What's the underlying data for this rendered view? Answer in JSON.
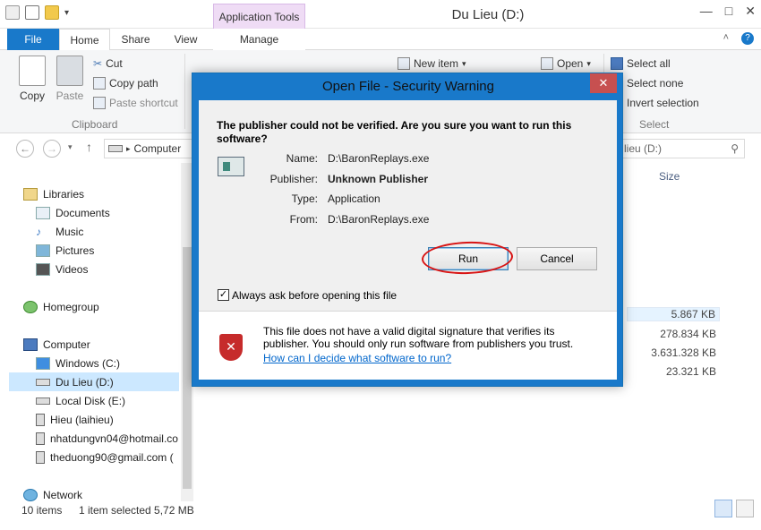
{
  "window": {
    "title": "Du Lieu (D:)",
    "app_tools_label": "Application Tools",
    "controls": [
      "—",
      "□",
      "✕"
    ]
  },
  "ribbon": {
    "tabs": {
      "file": "File",
      "home": "Home",
      "share": "Share",
      "view": "View",
      "manage": "Manage"
    },
    "clipboard": {
      "copy": "Copy",
      "paste": "Paste",
      "cut": "Cut",
      "copy_path": "Copy path",
      "paste_shortcut": "Paste shortcut",
      "group": "Clipboard"
    },
    "new_item": "New item",
    "open": "Open",
    "select": {
      "select_all": "Select all",
      "select_none": "Select none",
      "invert": "Invert selection",
      "group": "Select"
    }
  },
  "addressbar": {
    "path": "Computer",
    "search_placeholder": "lieu (D:)"
  },
  "navpane": {
    "libraries": "Libraries",
    "documents": "Documents",
    "music": "Music",
    "pictures": "Pictures",
    "videos": "Videos",
    "homegroup": "Homegroup",
    "computer": "Computer",
    "windows_c": "Windows (C:)",
    "du_lieu_d": "Du Lieu (D:)",
    "local_disk_e": "Local Disk (E:)",
    "hieu": "Hieu (laihieu)",
    "nhatdung": "nhatdungvn04@hotmail.co",
    "theduong": "theduong90@gmail.com (",
    "network": "Network"
  },
  "filelist": {
    "size_header": "Size",
    "sizes": [
      "5.867 KB",
      "278.834 KB",
      "3.631.328 KB",
      "23.321 KB"
    ]
  },
  "status": {
    "items": "10 items",
    "selected": "1 item selected  5,72 MB"
  },
  "dialog": {
    "title": "Open File - Security Warning",
    "question": "The publisher could not be verified.  Are you sure you want to run this software?",
    "labels": {
      "name": "Name:",
      "publisher": "Publisher:",
      "type": "Type:",
      "from": "From:"
    },
    "values": {
      "name": "D:\\BaronReplays.exe",
      "publisher": "Unknown Publisher",
      "type": "Application",
      "from": "D:\\BaronReplays.exe"
    },
    "run": "Run",
    "cancel": "Cancel",
    "checkbox_checked": true,
    "checkbox_label": "Always ask before opening this file",
    "warning": "This file does not have a valid digital signature that verifies its publisher.  You should only run software from publishers you trust.",
    "help_link": "How can I decide what software to run?"
  }
}
